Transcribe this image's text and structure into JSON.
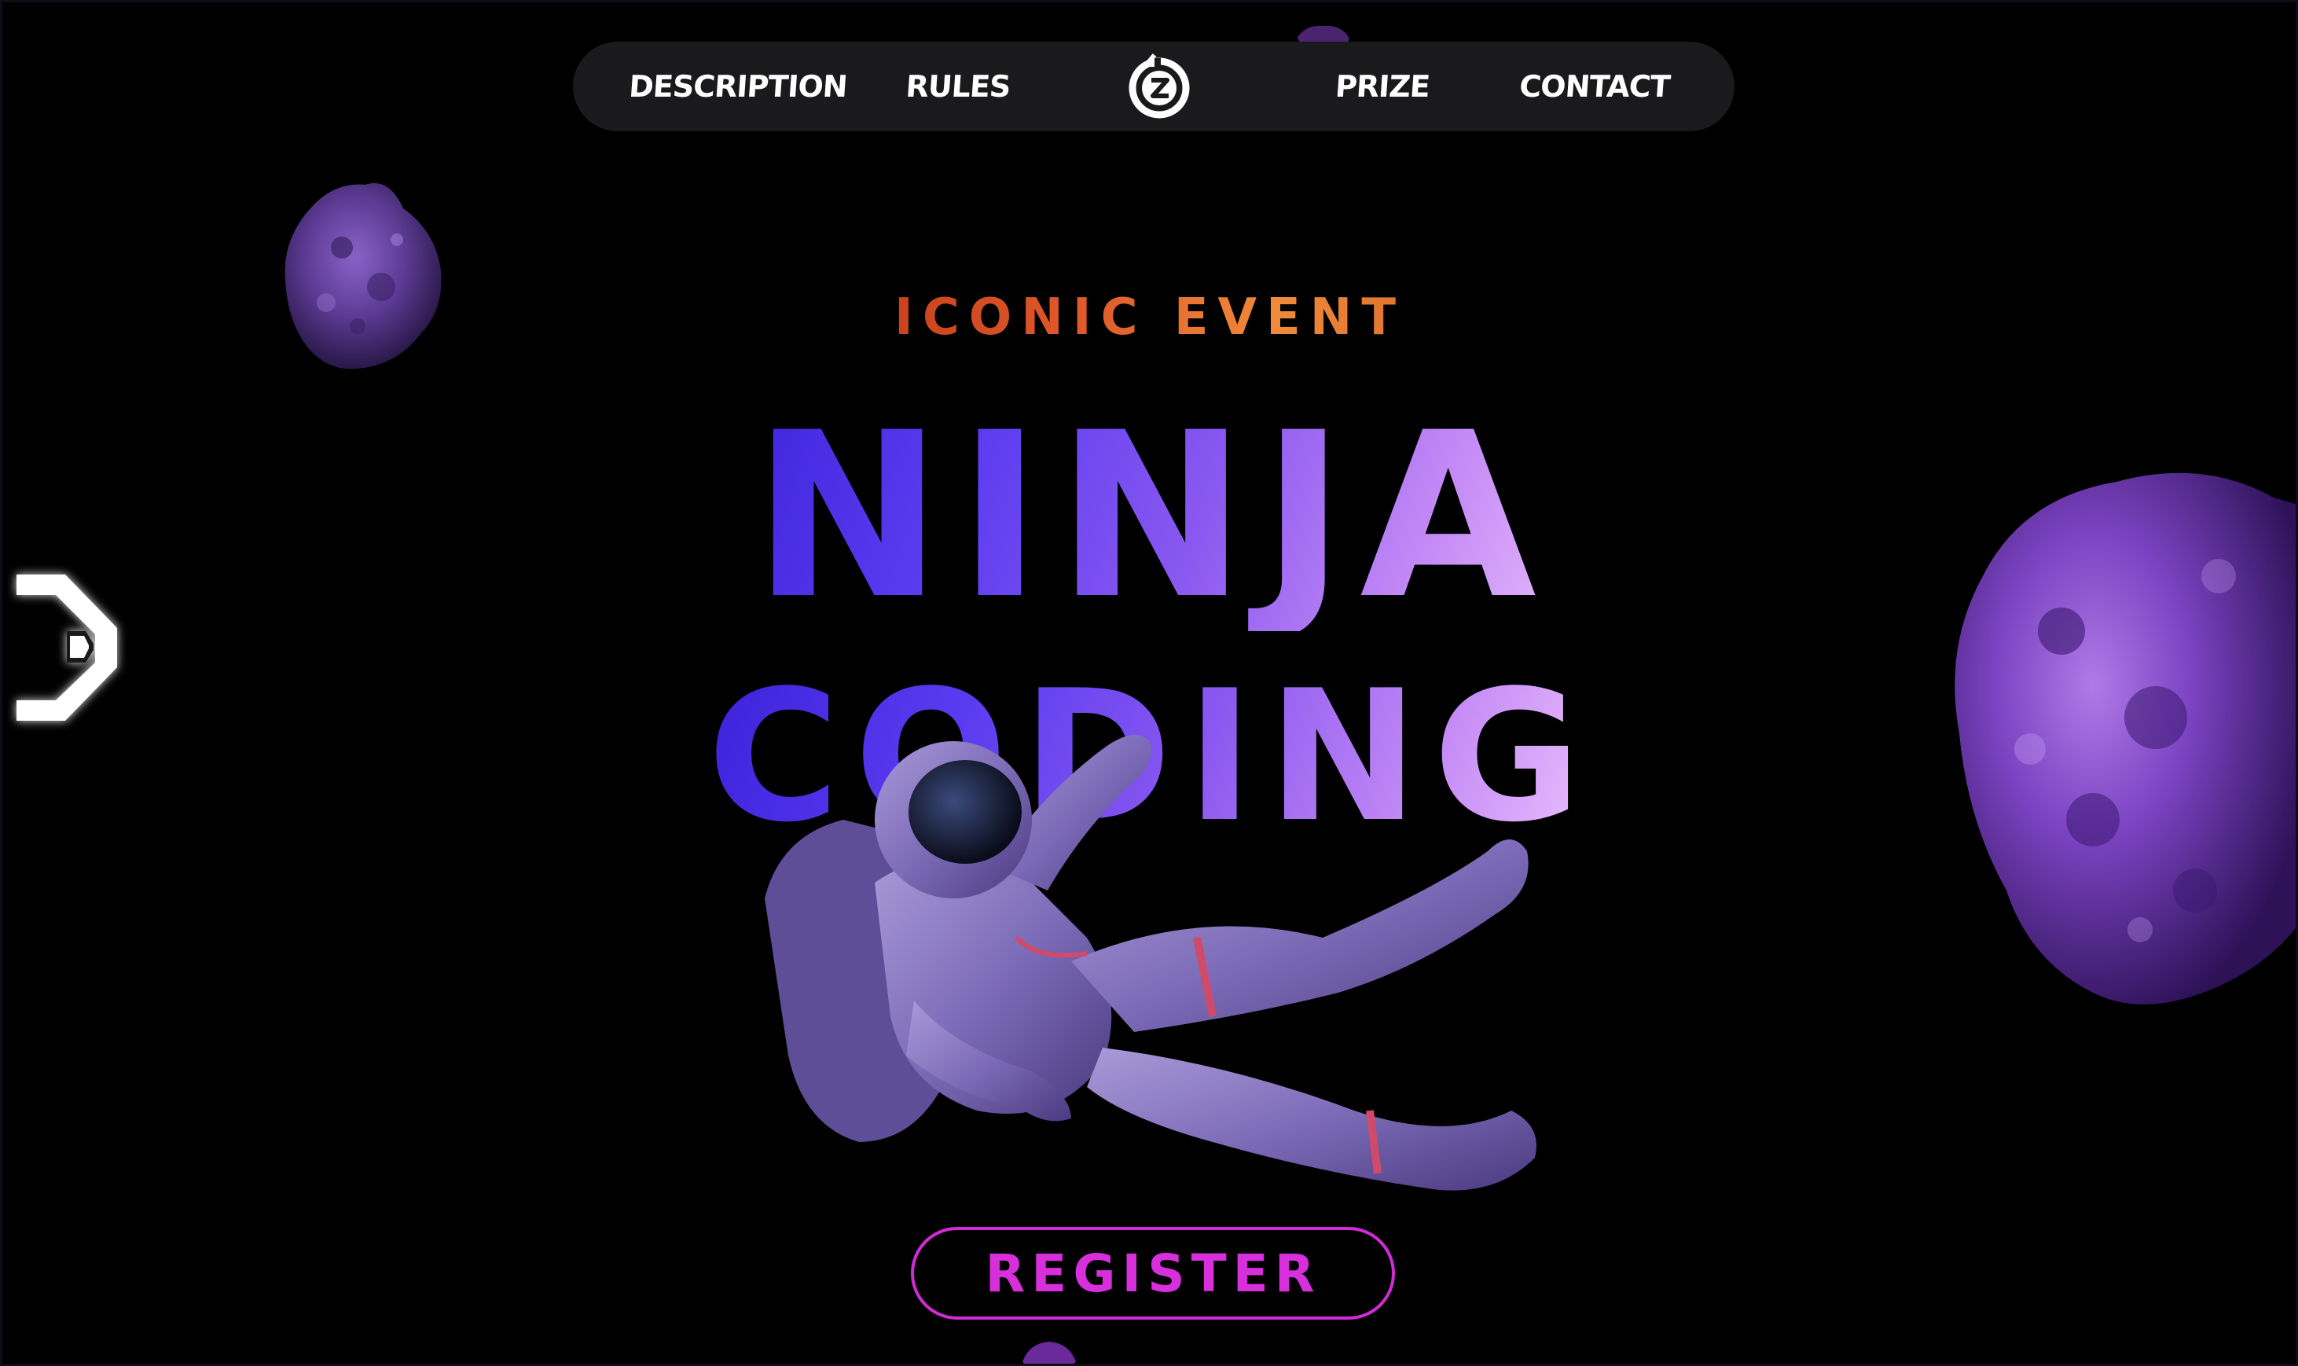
{
  "nav": {
    "items": [
      {
        "label": "DESCRIPTION"
      },
      {
        "label": "RULES"
      },
      {
        "label": "PRIZE"
      },
      {
        "label": "CONTACT"
      }
    ],
    "logo_icon": "circle-z-logo-icon"
  },
  "hero": {
    "eyebrow": "ICONIC EVENT",
    "title_line1": "NINJA",
    "title_line2": "CODING",
    "register_label": "REGISTER"
  },
  "decor": {
    "side_arrow_icon": "chevron-right-icon",
    "asteroid_icon": "asteroid-icon",
    "astronaut_icon": "astronaut-icon"
  },
  "colors": {
    "background": "#000000",
    "nav_bg": "#1a1a1c",
    "accent_magenta": "#d72fdc",
    "eyebrow_orange": "#e05a2a",
    "title_purple": "#5a3cf0",
    "asteroid_purple": "#6a3aa8"
  }
}
